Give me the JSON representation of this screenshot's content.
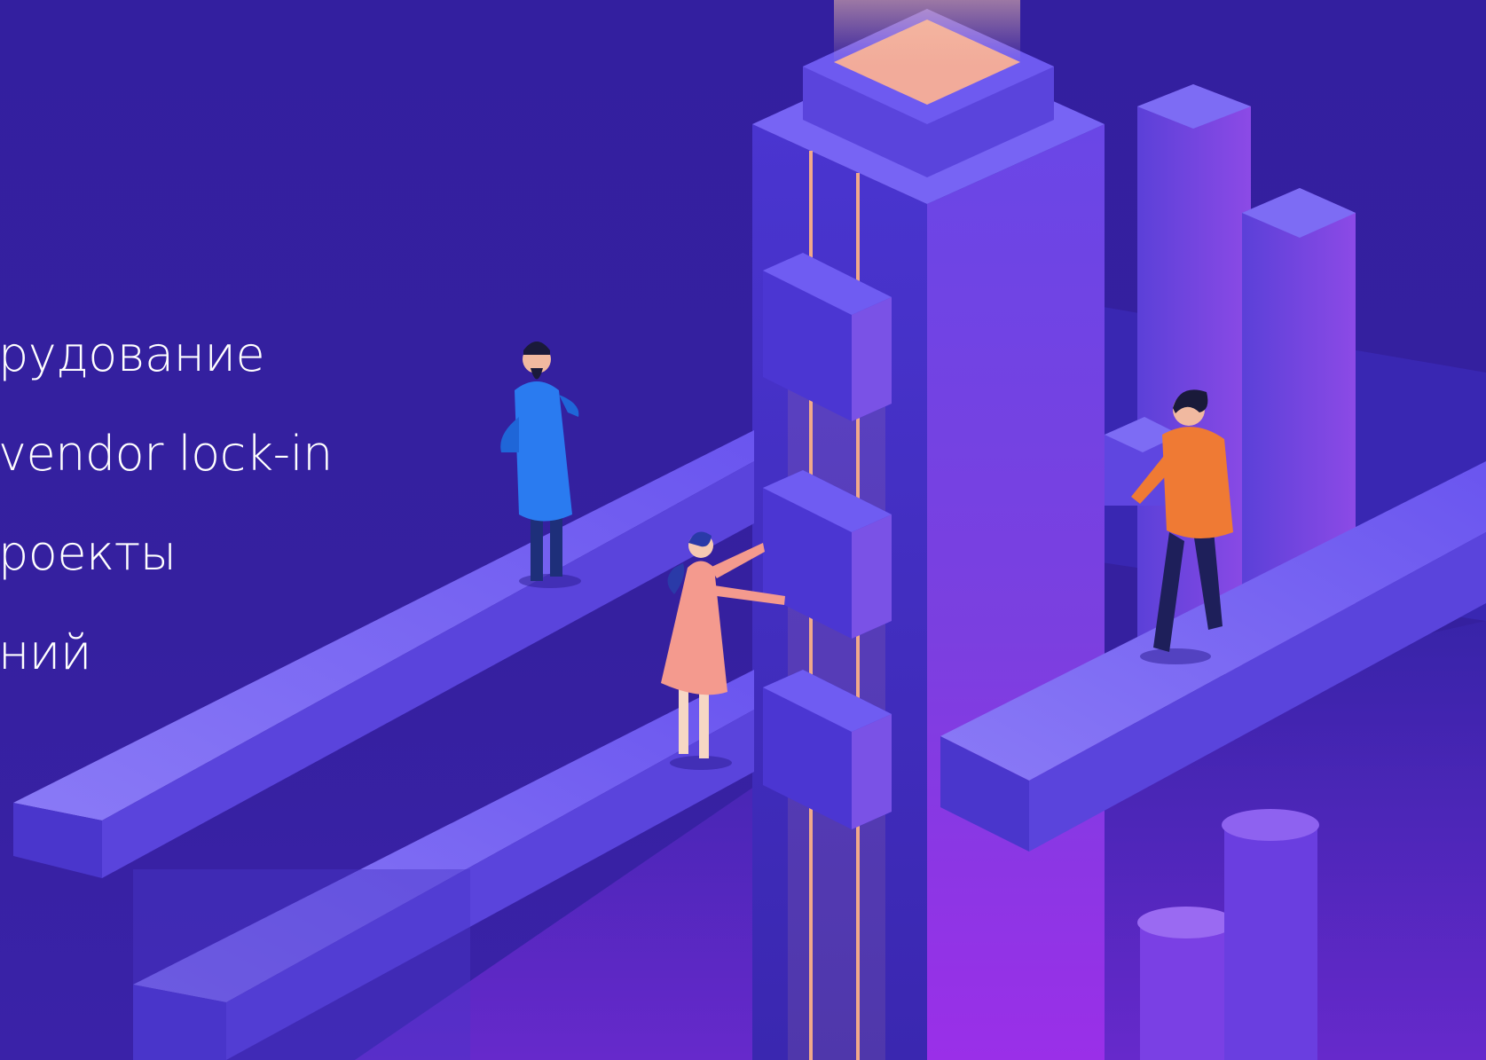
{
  "benefits": {
    "items": [
      {
        "text": "рудование"
      },
      {
        "text": "vendor lock-in"
      },
      {
        "text": "роекты"
      },
      {
        "text": "ний"
      }
    ]
  },
  "illustration": {
    "description_icon": "isometric-building-illustration-icon",
    "colors": {
      "background": "#331f9e",
      "tower": "#5b3ee0",
      "tower_light": "#8a4fe8",
      "beam": "#6a56f2",
      "accent_peach": "#f2a98a",
      "figure_blue": "#2a7bf0",
      "figure_pink": "#f49a8e",
      "figure_orange": "#ef7a34"
    }
  }
}
